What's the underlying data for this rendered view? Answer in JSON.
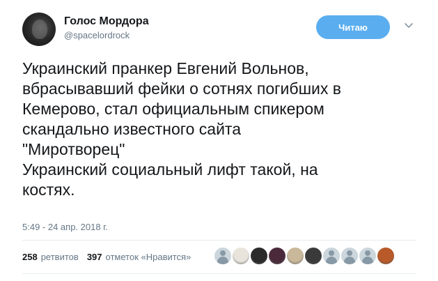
{
  "author": {
    "display_name": "Голос Мордора",
    "handle": "@spacelordrock"
  },
  "follow_button": {
    "label": "Читаю"
  },
  "tweet": {
    "text": "Украинский пранкер Евгений Вольнов,\nвбрасывавший фейки о сотнях погибших в\nКемерово, стал официальным спикером\nскандально известного сайта\n\"Миротворец\"\nУкраинский социальный лифт такой, на\nкостях.",
    "timestamp": "5:49 - 24 апр. 2018 г."
  },
  "stats": {
    "retweets_count": "258",
    "retweets_label": "ретвитов",
    "likes_count": "397",
    "likes_label": "отметок «Нравится»"
  },
  "likers": [
    {
      "name": "liker-avatar-1",
      "kind": "generic"
    },
    {
      "name": "liker-avatar-2",
      "kind": "photo",
      "color": "#e8e4dc"
    },
    {
      "name": "liker-avatar-3",
      "kind": "photo",
      "color": "#2a2a2a"
    },
    {
      "name": "liker-avatar-4",
      "kind": "photo",
      "color": "#4a2a3a"
    },
    {
      "name": "liker-avatar-5",
      "kind": "photo",
      "color": "#c9b89a"
    },
    {
      "name": "liker-avatar-6",
      "kind": "photo",
      "color": "#3a3a3a"
    },
    {
      "name": "liker-avatar-7",
      "kind": "generic"
    },
    {
      "name": "liker-avatar-8",
      "kind": "generic"
    },
    {
      "name": "liker-avatar-9",
      "kind": "generic"
    },
    {
      "name": "liker-avatar-10",
      "kind": "photo",
      "color": "#b85a2a"
    }
  ],
  "colors": {
    "accent": "#5aaef0",
    "muted_text": "#657786",
    "divider": "#e6ecf0"
  }
}
